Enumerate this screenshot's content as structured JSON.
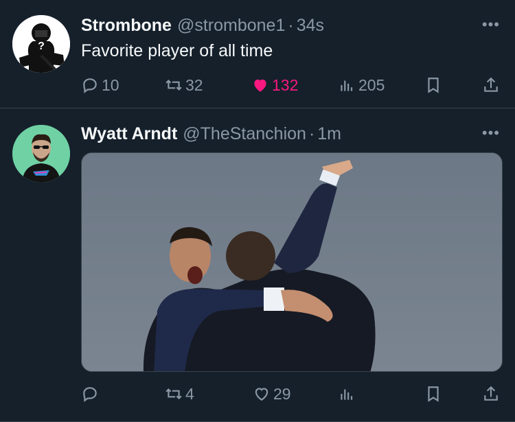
{
  "tweets": [
    {
      "name": "Strombone",
      "handle": "@strombone1",
      "separator": "·",
      "time": "34s",
      "more": "•••",
      "text": "Favorite player of all time",
      "actions": {
        "replies": "10",
        "retweets": "32",
        "likes": "132",
        "views": "205"
      },
      "liked": true
    },
    {
      "name": "Wyatt Arndt",
      "handle": "@TheStanchion",
      "separator": "·",
      "time": "1m",
      "more": "•••",
      "actions": {
        "replies": "",
        "retweets": "4",
        "likes": "29",
        "views": ""
      },
      "liked": false
    }
  ],
  "colors": {
    "background": "#15202b",
    "divider": "#38444d",
    "muted": "#8b98a5",
    "text": "#f7f9f9",
    "like": "#f91880"
  }
}
